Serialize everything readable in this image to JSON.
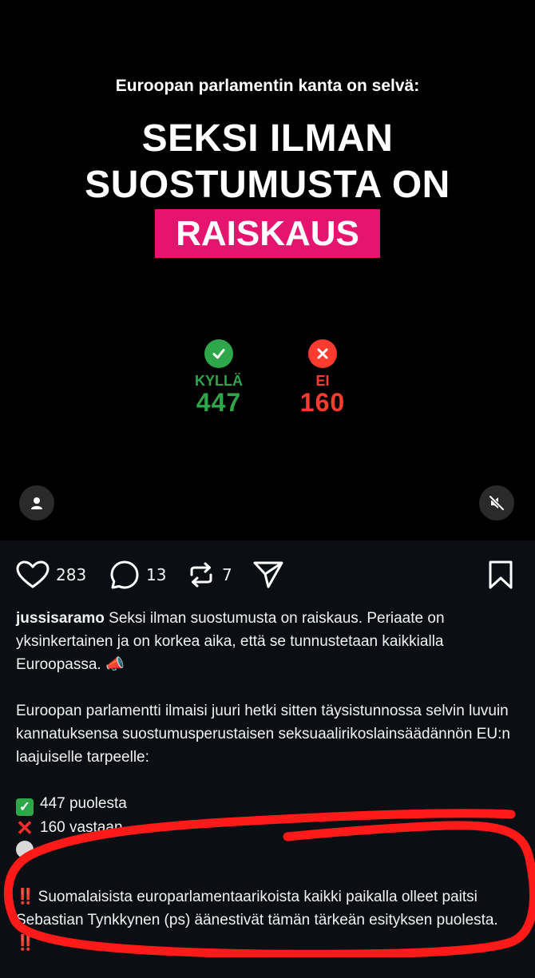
{
  "post": {
    "kicker": "Euroopan parlamentin kanta on selvä:",
    "headline_line1": "SEKSI ILMAN",
    "headline_line2": "SUOSTUMUSTA ON",
    "highlight": "RAISKAUS",
    "yes_label": "KYLLÄ",
    "yes_count": "447",
    "no_label": "EI",
    "no_count": "160"
  },
  "actions": {
    "likes": "283",
    "comments": "13",
    "reposts": "7"
  },
  "caption": {
    "username": "jussisaramo",
    "para1": " Seksi ilman suostumusta on raiskaus. Periaate on yksinkertainen ja on korkea aika, että se tunnustetaan kaikkialla Euroopassa. 📣",
    "para2": "Euroopan parlamentti ilmaisi juuri hetki sitten täysistunnossa selvin luvuin kannatuksensa suostumusperustaisen seksuaalirikoslainsäädännön EU:n laajuiselle tarpeelle:",
    "for": "447 puolesta",
    "against": "160 vastaan",
    "bang": "‼️",
    "para3": "Suomalaisista europarlamentaarikoista kaikki paikalla olleet paitsi Sebastian Tynkkynen (ps) äänestivät tämän tärkeän esityksen puolesta."
  },
  "colors": {
    "highlight": "#e5146f",
    "yes": "#2ea64a",
    "no": "#ff3b30",
    "annotation": "#ff1a1a"
  },
  "icons": [
    "check-icon",
    "x-icon",
    "user-icon",
    "mute-icon",
    "heart-icon",
    "comment-icon",
    "repost-icon",
    "send-icon",
    "bookmark-icon"
  ]
}
